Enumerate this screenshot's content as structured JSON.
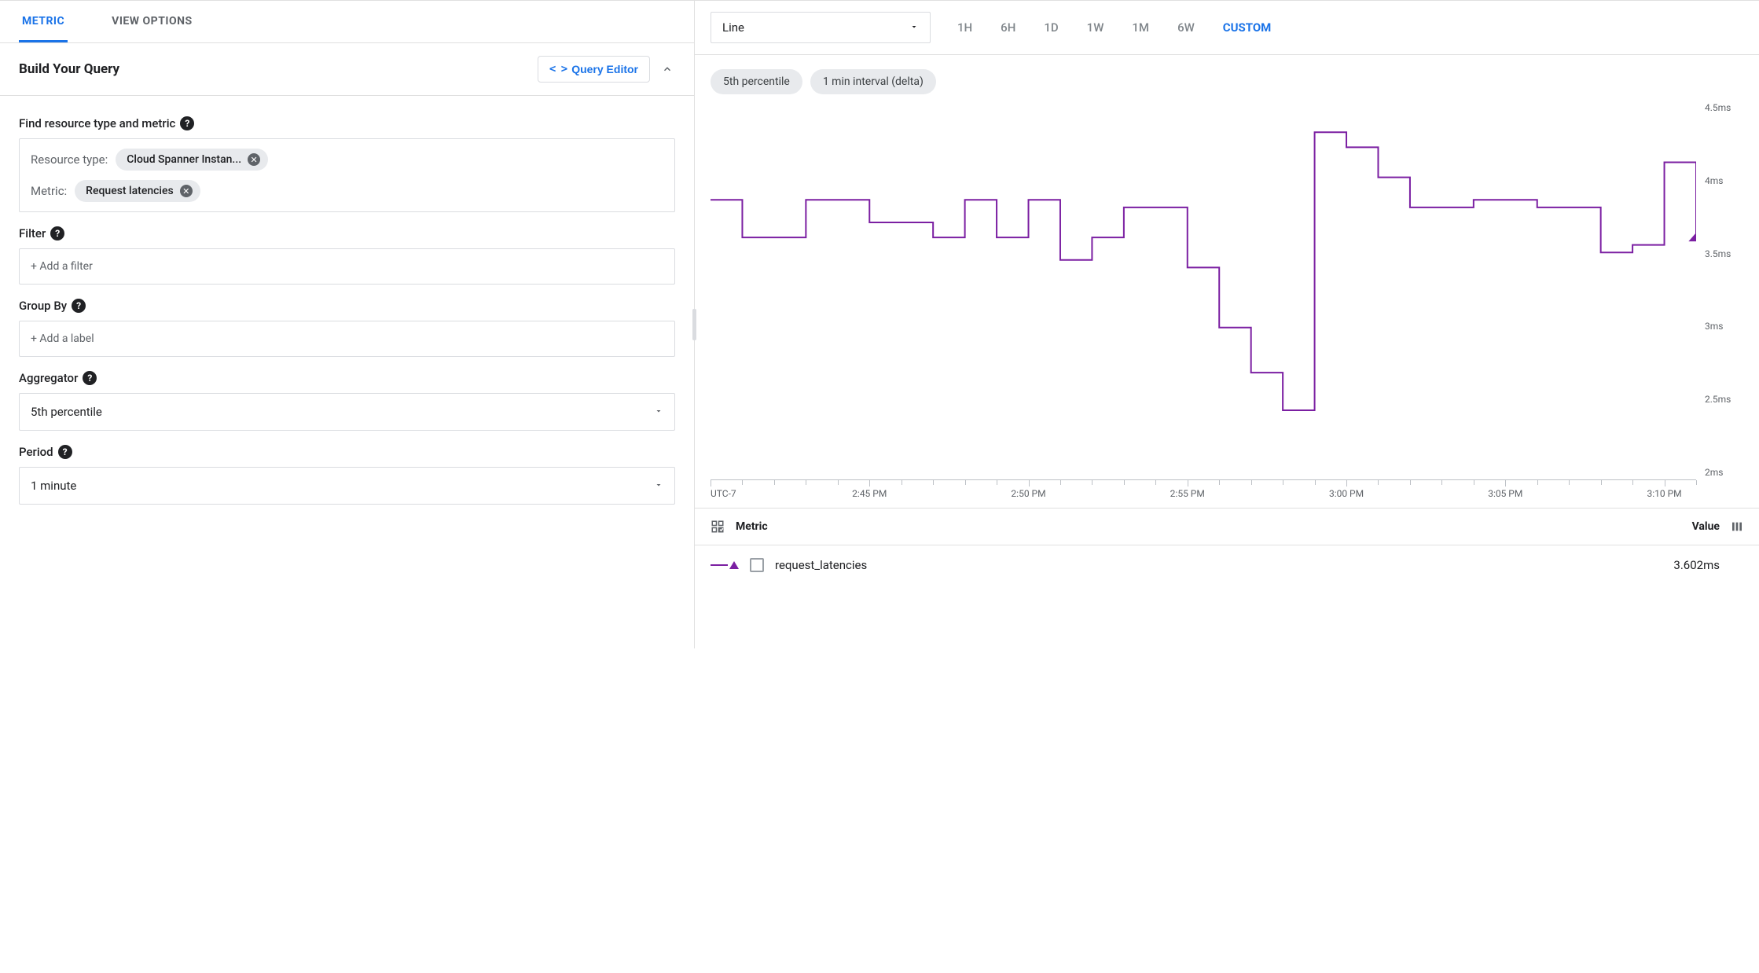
{
  "tabs": {
    "metric": "METRIC",
    "view_options": "VIEW OPTIONS"
  },
  "build": {
    "title": "Build Your Query",
    "query_editor": "Query Editor",
    "find_label": "Find resource type and metric",
    "resource_type_key": "Resource type:",
    "resource_type_chip": "Cloud Spanner Instan...",
    "metric_key": "Metric:",
    "metric_chip": "Request latencies",
    "filter_label": "Filter",
    "filter_placeholder": "+ Add a filter",
    "groupby_label": "Group By",
    "groupby_placeholder": "+ Add a label",
    "aggregator_label": "Aggregator",
    "aggregator_value": "5th percentile",
    "period_label": "Period",
    "period_value": "1 minute"
  },
  "toolbar": {
    "chart_type": "Line",
    "ranges": [
      "1H",
      "6H",
      "1D",
      "1W",
      "1M",
      "6W",
      "CUSTOM"
    ],
    "active_range": "CUSTOM"
  },
  "pills": {
    "p0": "5th percentile",
    "p1": "1 min interval (delta)"
  },
  "chart": {
    "timezone": "UTC-7",
    "y_ticks": [
      "4.5ms",
      "4ms",
      "3.5ms",
      "3ms",
      "2.5ms",
      "2ms"
    ],
    "x_major_labels": [
      "2:45 PM",
      "2:50 PM",
      "2:55 PM",
      "3:00 PM",
      "3:05 PM",
      "3:10 PM"
    ]
  },
  "legend": {
    "metric_header": "Metric",
    "value_header": "Value",
    "series_name": "request_latencies",
    "series_value": "3.602ms"
  },
  "chart_data": {
    "type": "line",
    "title": "",
    "xlabel": "",
    "ylabel": "",
    "ylim": [
      2.0,
      4.5
    ],
    "x": [
      "2:40",
      "2:41",
      "2:42",
      "2:43",
      "2:44",
      "2:45",
      "2:46",
      "2:47",
      "2:48",
      "2:49",
      "2:50",
      "2:51",
      "2:52",
      "2:53",
      "2:54",
      "2:55",
      "2:56",
      "2:57",
      "2:58",
      "2:59",
      "3:00",
      "3:01",
      "3:02",
      "3:03",
      "3:04",
      "3:05",
      "3:06",
      "3:07",
      "3:08",
      "3:09",
      "3:10",
      "3:11"
    ],
    "series": [
      {
        "name": "request_latencies",
        "color": "#7b1fa2",
        "values": [
          3.85,
          3.6,
          3.6,
          3.85,
          3.85,
          3.7,
          3.7,
          3.6,
          3.85,
          3.6,
          3.85,
          3.45,
          3.6,
          3.8,
          3.8,
          3.4,
          3.0,
          2.7,
          2.45,
          4.3,
          4.2,
          4.0,
          3.8,
          3.8,
          3.85,
          3.85,
          3.8,
          3.8,
          3.5,
          3.55,
          4.1,
          3.6
        ]
      }
    ]
  }
}
